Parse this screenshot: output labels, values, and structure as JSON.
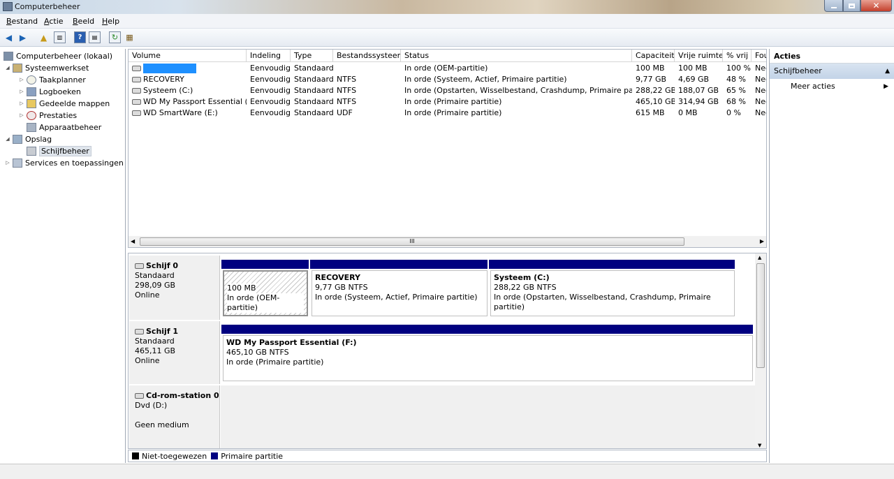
{
  "window": {
    "title": "Computerbeheer"
  },
  "menu": [
    "Bestand",
    "Actie",
    "Beeld",
    "Help"
  ],
  "tree": {
    "root": "Computerbeheer (lokaal)",
    "items": [
      {
        "label": "Systeemwerkset",
        "level": 1
      },
      {
        "label": "Taakplanner",
        "level": 2
      },
      {
        "label": "Logboeken",
        "level": 2
      },
      {
        "label": "Gedeelde mappen",
        "level": 2
      },
      {
        "label": "Prestaties",
        "level": 2
      },
      {
        "label": "Apparaatbeheer",
        "level": 2
      },
      {
        "label": "Opslag",
        "level": 1
      },
      {
        "label": "Schijfbeheer",
        "level": 2,
        "selected": true
      },
      {
        "label": "Services en toepassingen",
        "level": 1
      }
    ]
  },
  "volume_table": {
    "columns": [
      "Volume",
      "Indeling",
      "Type",
      "Bestandssysteem",
      "Status",
      "Capaciteit",
      "Vrije ruimte",
      "% vrij",
      "Fou"
    ],
    "rows": [
      [
        "",
        "Eenvoudig",
        "Standaard",
        "",
        "In orde (OEM-partitie)",
        "100 MB",
        "100 MB",
        "100 %",
        "Nee"
      ],
      [
        "RECOVERY",
        "Eenvoudig",
        "Standaard",
        "NTFS",
        "In orde (Systeem, Actief, Primaire partitie)",
        "9,77 GB",
        "4,69 GB",
        "48 %",
        "Nee"
      ],
      [
        "Systeem (C:)",
        "Eenvoudig",
        "Standaard",
        "NTFS",
        "In orde (Opstarten, Wisselbestand, Crashdump, Primaire partitie)",
        "288,22 GB",
        "188,07 GB",
        "65 %",
        "Nee"
      ],
      [
        "WD My Passport Essential (F:)",
        "Eenvoudig",
        "Standaard",
        "NTFS",
        "In orde (Primaire partitie)",
        "465,10 GB",
        "314,94 GB",
        "68 %",
        "Nee"
      ],
      [
        "WD SmartWare (E:)",
        "Eenvoudig",
        "Standaard",
        "UDF",
        "In orde (Primaire partitie)",
        "615 MB",
        "0 MB",
        "0 %",
        "Nee"
      ]
    ],
    "scroll_glyph": "III"
  },
  "disks": {
    "disk0": {
      "name": "Schijf 0",
      "type": "Standaard",
      "size": "298,09 GB",
      "status": "Online",
      "partitions": [
        {
          "name": "",
          "size": "100 MB",
          "status": "In orde (OEM-partitie)"
        },
        {
          "name": "RECOVERY",
          "size": "9,77 GB NTFS",
          "status": "In orde (Systeem, Actief, Primaire partitie)"
        },
        {
          "name": "Systeem  (C:)",
          "size": "288,22 GB NTFS",
          "status": "In orde (Opstarten, Wisselbestand, Crashdump, Primaire partitie)"
        }
      ]
    },
    "disk1": {
      "name": "Schijf 1",
      "type": "Standaard",
      "size": "465,11 GB",
      "status": "Online",
      "partitions": [
        {
          "name": "WD My Passport Essential  (F:)",
          "size": "465,10 GB NTFS",
          "status": "In orde (Primaire partitie)"
        }
      ]
    },
    "cdrom0": {
      "name": "Cd-rom-station 0",
      "type": "Dvd (D:)",
      "status": "Geen medium"
    }
  },
  "legend": [
    {
      "label": "Niet-toegewezen",
      "color": "#000000"
    },
    {
      "label": "Primaire partitie",
      "color": "#000080"
    }
  ],
  "actions": {
    "header": "Acties",
    "section": "Schijfbeheer",
    "item": "Meer acties"
  }
}
